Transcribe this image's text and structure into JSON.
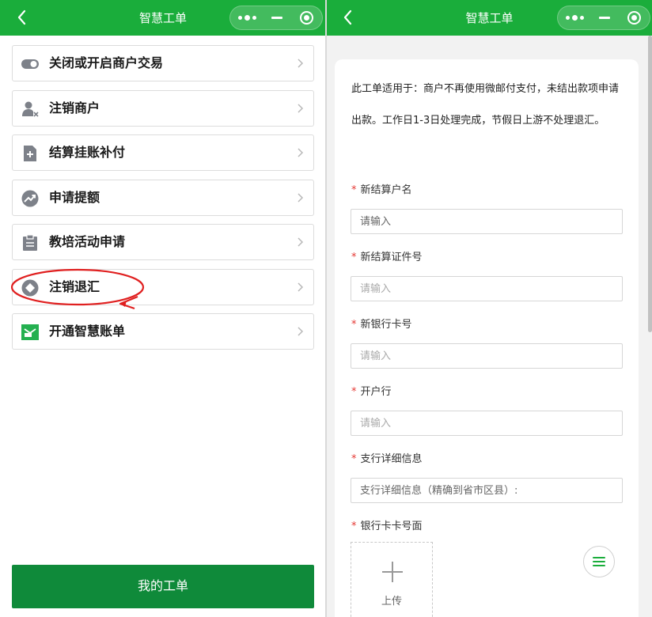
{
  "left": {
    "nav": {
      "title": "智慧工单"
    },
    "menu_items": [
      {
        "label": "关闭或开启商户交易",
        "icon": "toggle-icon"
      },
      {
        "label": "注销商户",
        "icon": "user-remove-icon"
      },
      {
        "label": "结算挂账补付",
        "icon": "add-document-icon"
      },
      {
        "label": "申请提额",
        "icon": "trend-up-icon"
      },
      {
        "label": "教培活动申请",
        "icon": "clipboard-icon"
      },
      {
        "label": "注销退汇",
        "icon": "diamond-icon"
      },
      {
        "label": "开通智慧账单",
        "icon": "envelope-icon"
      }
    ],
    "annotation": {
      "highlighted_item": "注销退汇",
      "color": "#e02020"
    },
    "bottom_button": "我的工单"
  },
  "right": {
    "nav": {
      "title": "智慧工单"
    },
    "notice": "此工单适用于：商户不再使用微邮付支付，未结出款项申请出款。工作日1-3日处理完成，节假日上游不处理退汇。",
    "required_mark": "*",
    "fields": [
      {
        "label": "新结算户名",
        "placeholder": "请输入"
      },
      {
        "label": "新结算证件号",
        "placeholder": "请输入"
      },
      {
        "label": "新银行卡号",
        "placeholder": "请输入"
      },
      {
        "label": "开户行",
        "placeholder": "请输入"
      },
      {
        "label": "支行详细信息",
        "placeholder": "支行详细信息（精确到省市区县）:"
      },
      {
        "label": "银行卡卡号面"
      }
    ],
    "upload": {
      "label": "上传",
      "icon": "plus-icon"
    },
    "fab_icon": "list-menu-icon"
  },
  "colors": {
    "nav_green": "#1aad3b",
    "button_green": "#0f8a3a",
    "required_red": "#e53935"
  }
}
